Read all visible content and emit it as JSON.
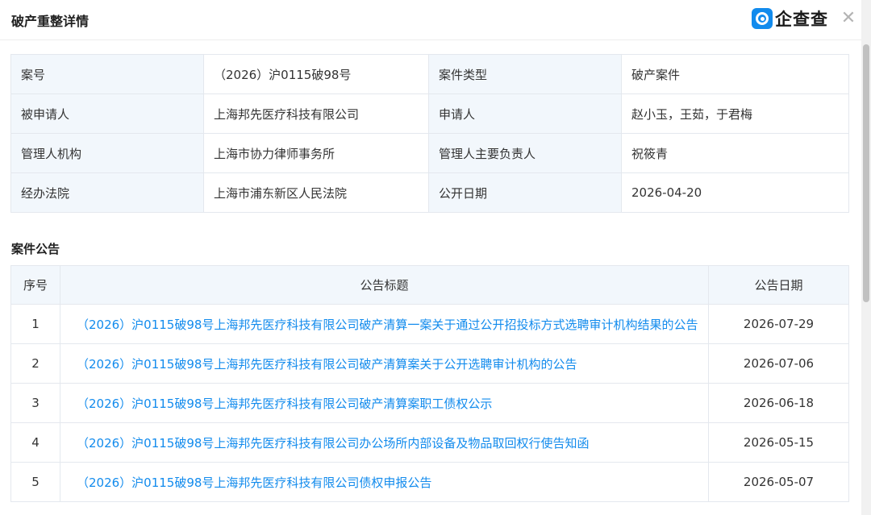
{
  "header": {
    "title": "破产重整详情",
    "brand": "企查查",
    "close_symbol": "✕"
  },
  "case_info": {
    "rows": [
      {
        "label1": "案号",
        "value1": "（2026）沪0115破98号",
        "label2": "案件类型",
        "value2": "破产案件"
      },
      {
        "label1": "被申请人",
        "value1": "上海邦先医疗科技有限公司",
        "label2": "申请人",
        "value2": "赵小玉，王茹，于君梅"
      },
      {
        "label1": "管理人机构",
        "value1": "上海市协力律师事务所",
        "label2": "管理人主要负责人",
        "value2": "祝筱青"
      },
      {
        "label1": "经办法院",
        "value1": "上海市浦东新区人民法院",
        "label2": "公开日期",
        "value2": "2026-04-20"
      }
    ]
  },
  "announcements": {
    "section_title": "案件公告",
    "headers": {
      "index": "序号",
      "title": "公告标题",
      "date": "公告日期"
    },
    "rows": [
      {
        "index": "1",
        "title": "（2026）沪0115破98号上海邦先医疗科技有限公司破产清算一案关于通过公开招投标方式选聘审计机构结果的公告",
        "date": "2026-07-29"
      },
      {
        "index": "2",
        "title": "（2026）沪0115破98号上海邦先医疗科技有限公司破产清算案关于公开选聘审计机构的公告",
        "date": "2026-07-06"
      },
      {
        "index": "3",
        "title": "（2026）沪0115破98号上海邦先医疗科技有限公司破产清算案职工债权公示",
        "date": "2026-06-18"
      },
      {
        "index": "4",
        "title": "（2026）沪0115破98号上海邦先医疗科技有限公司办公场所内部设备及物品取回权行使告知函",
        "date": "2026-05-15"
      },
      {
        "index": "5",
        "title": "（2026）沪0115破98号上海邦先医疗科技有限公司债权申报公告",
        "date": "2026-05-07"
      }
    ]
  },
  "colors": {
    "link": "#128bed",
    "label_bg": "#f2f7fc",
    "border": "#e4e8ee",
    "brand": "#128bed"
  },
  "icons": {
    "logo": "qichacha-logo-icon",
    "close": "close-icon"
  }
}
